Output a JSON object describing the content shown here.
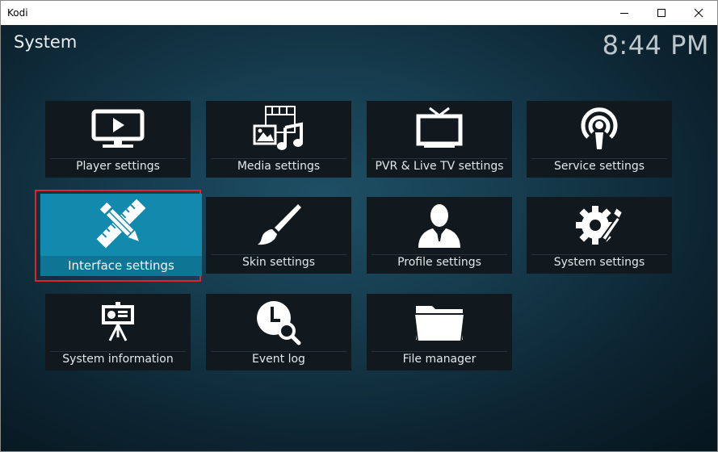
{
  "window": {
    "title": "Kodi",
    "controls": [
      "minimize",
      "maximize",
      "close"
    ]
  },
  "header": {
    "section_title": "System",
    "clock": "8:44 PM"
  },
  "tiles": [
    {
      "label": "Player settings",
      "icon": "monitor-play-icon"
    },
    {
      "label": "Media settings",
      "icon": "media-film-music-icon"
    },
    {
      "label": "PVR & Live TV settings",
      "icon": "tv-antenna-icon"
    },
    {
      "label": "Service settings",
      "icon": "broadcast-podcast-icon"
    },
    {
      "label": "Interface settings",
      "icon": "pencil-ruler-icon",
      "focused": true
    },
    {
      "label": "Skin settings",
      "icon": "paintbrush-icon"
    },
    {
      "label": "Profile settings",
      "icon": "user-profile-icon"
    },
    {
      "label": "System settings",
      "icon": "gear-wrench-icon"
    },
    {
      "label": "System information",
      "icon": "presentation-board-icon"
    },
    {
      "label": "Event log",
      "icon": "clock-search-icon"
    },
    {
      "label": "File manager",
      "icon": "folder-icon"
    }
  ],
  "colors": {
    "focused_tile": "#128aae",
    "tile_background": "#11191e",
    "highlight_frame": "#e0242b"
  }
}
